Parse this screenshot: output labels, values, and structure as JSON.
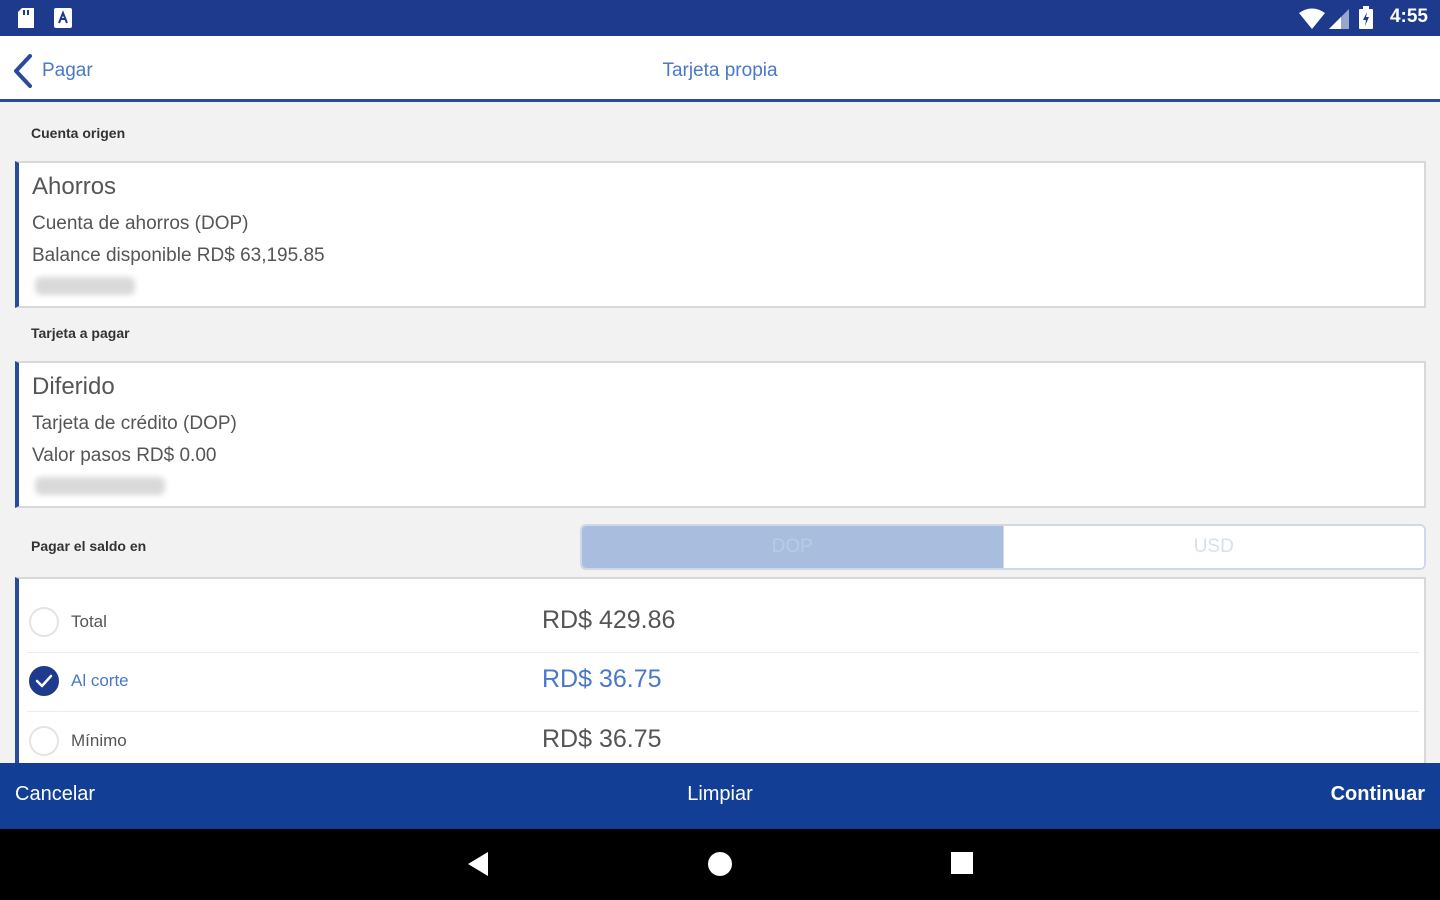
{
  "status_bar": {
    "time": "4:55",
    "icons": [
      "sd-card-icon",
      "app-notification-icon",
      "wifi-icon",
      "cell-signal-icon",
      "battery-icon"
    ]
  },
  "header": {
    "back_label": "Pagar",
    "title": "Tarjeta propia"
  },
  "source_account": {
    "section_label": "Cuenta origen",
    "name": "Ahorros",
    "type": "Cuenta de ahorros (DOP)",
    "balance": "Balance disponible RD$ 63,195.85"
  },
  "card_to_pay": {
    "section_label": "Tarjeta a pagar",
    "name": "Diferido",
    "type": "Tarjeta de crédito (DOP)",
    "value": "Valor pasos RD$ 0.00"
  },
  "currency": {
    "label": "Pagar el saldo en",
    "options": [
      "DOP",
      "USD"
    ],
    "selected": "DOP"
  },
  "payment_options": [
    {
      "label": "Total",
      "amount": "RD$ 429.86",
      "checked": false
    },
    {
      "label": "Al corte",
      "amount": "RD$ 36.75",
      "checked": true
    },
    {
      "label": "Mínimo",
      "amount": "RD$ 36.75",
      "checked": false
    }
  ],
  "actions": {
    "cancel": "Cancelar",
    "clear": "Limpiar",
    "continue": "Continuar"
  },
  "colors": {
    "primary": "#1e3a8c",
    "accent_text": "#4a78c8",
    "bottom_bar": "#123f95",
    "segment_active": "#a9bedf"
  }
}
